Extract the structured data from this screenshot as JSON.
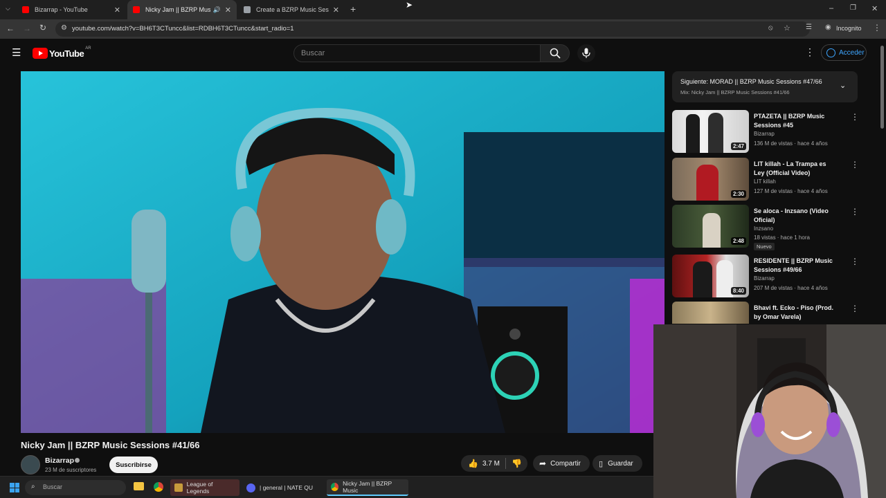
{
  "browser": {
    "tabs": [
      {
        "label": "Bizarrap - YouTube",
        "active": false
      },
      {
        "label": "Nicky Jam || BZRP Music Se",
        "active": true
      },
      {
        "label": "Create a BZRP Music Sessions",
        "active": false
      }
    ],
    "url": "youtube.com/watch?v=BH6T3CTuncc&list=RDBH6T3CTuncc&start_radio=1",
    "profile_label": "Incognito"
  },
  "youtube": {
    "logo_text": "YouTube",
    "region": "AR",
    "search_placeholder": "Buscar",
    "signin_label": "Acceder"
  },
  "video": {
    "title": "Nicky Jam || BZRP Music Sessions #41/66",
    "channel": "Bizarrap",
    "subscribers": "23 M de suscriptores",
    "subscribe_label": "Suscribirse",
    "likes": "3.7 M",
    "share_label": "Compartir",
    "save_label": "Guardar"
  },
  "upnext": {
    "next_label": "Siguiente: MORAD || BZRP Music Sessions #47/66",
    "mix_label": "Mix: Nicky Jam || BZRP Music Sessions #41/66"
  },
  "recommendations": [
    {
      "title": "PTAZETA || BZRP Music Sessions #45",
      "channel": "Bizarrap",
      "stats": "136 M de vistas · hace 4 años",
      "duration": "2:47",
      "badge": ""
    },
    {
      "title": "LIT killah - La Trampa es Ley (Official Video)",
      "channel": "LIT killah",
      "stats": "127 M de vistas · hace 4 años",
      "duration": "2:30",
      "badge": ""
    },
    {
      "title": "Se aloca - Inzsano (Video Oficial)",
      "channel": "Inzsano",
      "stats": "18 vistas · hace 1 hora",
      "duration": "2:48",
      "badge": "Nuevo"
    },
    {
      "title": "RESIDENTE || BZRP Music Sessions #49/66",
      "channel": "Bizarrap",
      "stats": "207 M de vistas · hace 4 años",
      "duration": "8:40",
      "badge": ""
    },
    {
      "title": "Bhavi ft. Ecko - Piso (Prod. by Omar Varela)",
      "channel": "",
      "stats": "",
      "duration": "",
      "badge": ""
    }
  ],
  "taskbar": {
    "search_placeholder": "Buscar",
    "items": [
      "League of Legends",
      "| general | NATE QU",
      "Nicky Jam || BZRP Music"
    ]
  },
  "colors": {
    "youtube_red": "#ff0000",
    "accent_blue": "#3ea6ff",
    "background": "#0f0f0f"
  }
}
